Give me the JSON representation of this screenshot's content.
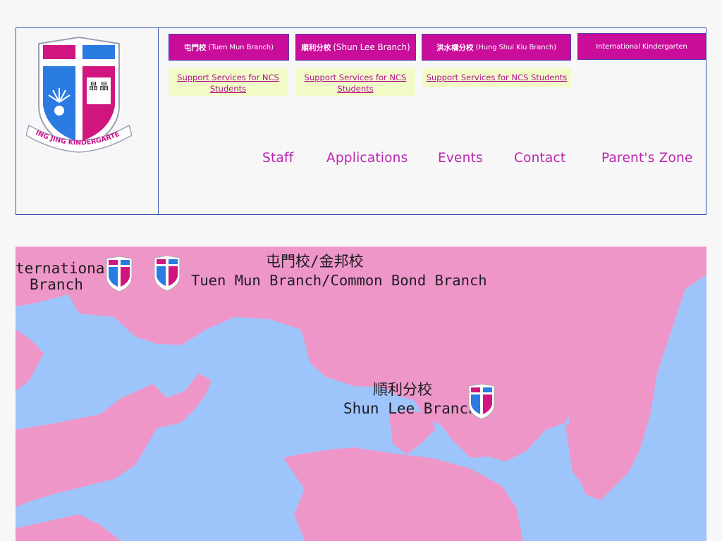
{
  "logo": {
    "text": "JING JING KINDERGARTEN",
    "glyph": "晶"
  },
  "branches": [
    {
      "zh": "屯門校",
      "en": "(Tuen Mun Branch)"
    },
    {
      "zh": "順利分校",
      "en": "(Shun Lee Branch)"
    },
    {
      "zh": "洪水橋分校",
      "en": "(Hung Shui Kiu Branch)"
    },
    {
      "zh": "",
      "en": "International Kindergarten"
    }
  ],
  "ncs": [
    "Support Services for NCS Students",
    "Support Services for NCS Students",
    "Support Services for NCS Students"
  ],
  "nav": [
    "Staff",
    "Applications",
    "Events",
    "Contact",
    "Parent's Zone"
  ],
  "map": {
    "international_line1": "ternational",
    "international_line2": "Branch",
    "tuenmun_zh": "屯門校/金邦校",
    "tuenmun_en": "Tuen Mun Branch/Common Bond Branch",
    "shunlee_zh": "順利分校",
    "shunlee_en": "Shun Lee Branch"
  },
  "colors": {
    "magenta": "#c90d9a",
    "blue_border": "#3a4fb0",
    "nav": "#b927b0",
    "land": "#ef96c8",
    "sea": "#9ec5fb",
    "ncs_bg": "#f2fbc8"
  }
}
